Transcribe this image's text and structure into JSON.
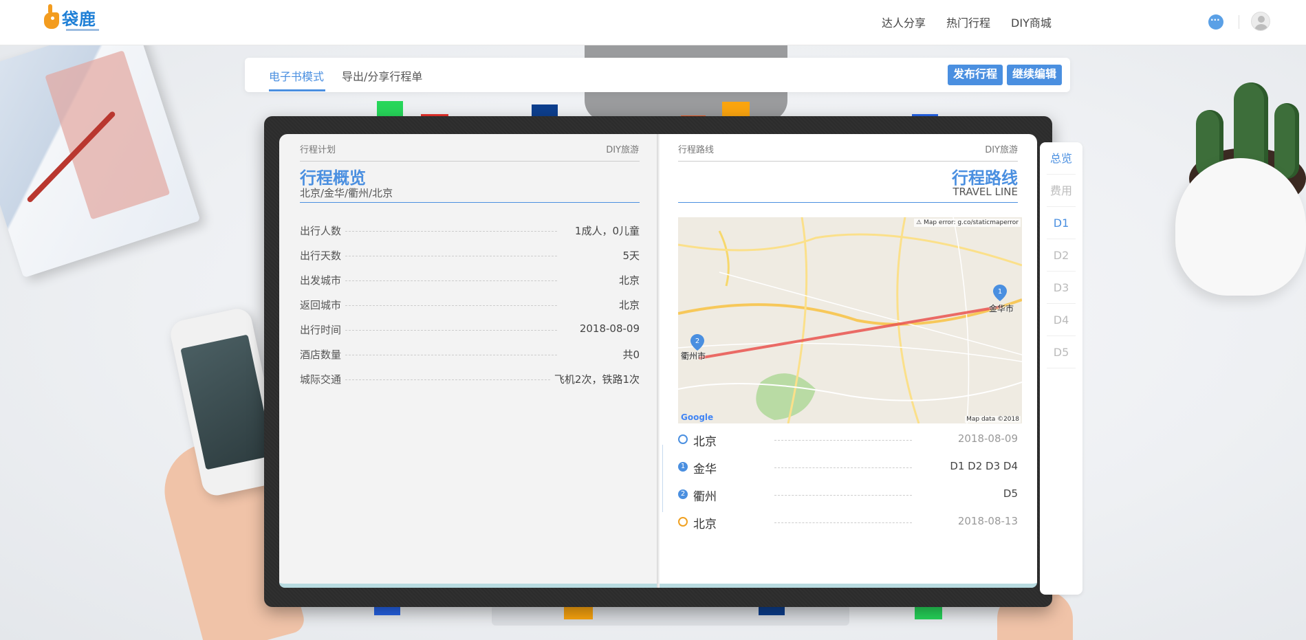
{
  "header": {
    "logo_text": "袋鹿",
    "nav": [
      "达人分享",
      "热门行程",
      "DIY商城"
    ]
  },
  "toolbar": {
    "tabs": [
      "电子书模式",
      "导出/分享行程单"
    ],
    "publish_label": "发布行程",
    "edit_label": "继续编辑"
  },
  "left_page": {
    "header_left": "行程计划",
    "header_right": "DIY旅游",
    "title": "行程概览",
    "route_summary": "北京/金华/衢州/北京",
    "rows": [
      {
        "label": "出行人数",
        "value": "1成人，0儿童"
      },
      {
        "label": "出行天数",
        "value": "5天"
      },
      {
        "label": "出发城市",
        "value": "北京"
      },
      {
        "label": "返回城市",
        "value": "北京"
      },
      {
        "label": "出行时间",
        "value": "2018-08-09"
      },
      {
        "label": "酒店数量",
        "value": "共0"
      },
      {
        "label": "城际交通",
        "value": "飞机2次，铁路1次"
      }
    ]
  },
  "right_page": {
    "header_left": "行程路线",
    "header_right": "DIY旅游",
    "title": "行程路线",
    "subtitle": "TRAVEL LINE",
    "map": {
      "error_text": "⚠ Map error: g.co/staticmaperror",
      "google_text": "Google",
      "data_text": "Map data ©2018",
      "city_a": "金华市",
      "city_b": "衢州市",
      "pin_a": "1",
      "pin_b": "2"
    },
    "route": [
      {
        "marker": "start",
        "city": "北京",
        "value": "2018-08-09"
      },
      {
        "marker": "1",
        "city": "金华",
        "value": "D1 D2 D3 D4"
      },
      {
        "marker": "2",
        "city": "衢州",
        "value": "D5"
      },
      {
        "marker": "end",
        "city": "北京",
        "value": "2018-08-13"
      }
    ]
  },
  "side_nav": [
    "总览",
    "费用",
    "D1",
    "D2",
    "D3",
    "D4",
    "D5"
  ],
  "colors": {
    "accent": "#4a8fe0",
    "route_line": "#e9534f",
    "end_marker": "#f0a020"
  }
}
